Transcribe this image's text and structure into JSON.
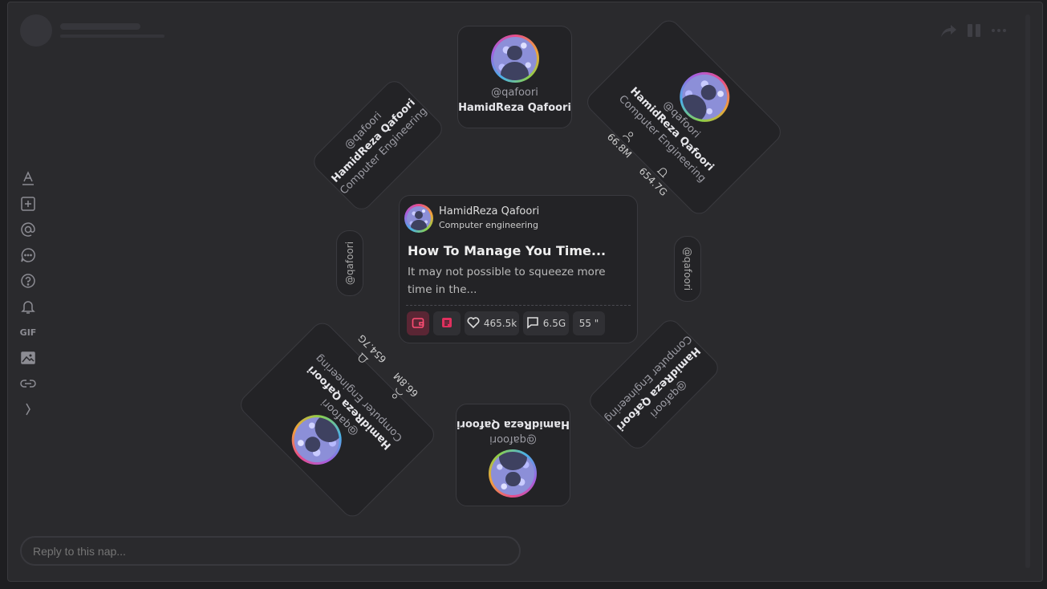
{
  "reply": {
    "placeholder": "Reply to this nap..."
  },
  "toolbar": {
    "gif_label": "GIF"
  },
  "profile": {
    "handle": "@qafoori",
    "name": "HamidReza Qafoori",
    "field": "Computer Engineering",
    "followers": "66.8M",
    "likes": "654.7G"
  },
  "post": {
    "author_name": "HamidReza Qafoori",
    "author_field": "Computer engineering",
    "title": "How To Manage You Time...",
    "excerpt": "It may not possible to squeeze more time in the...",
    "likes": "465.5k",
    "comments": "6.5G",
    "duration": "55 \""
  },
  "colors": {
    "accent": "#e0305e",
    "background": "#2a2a2d",
    "card": "#232326"
  },
  "icons": [
    "text-format-icon",
    "add-icon",
    "mention-icon",
    "chat-icon",
    "help-icon",
    "bell-icon",
    "image-icon",
    "link-icon",
    "chevron-right-icon",
    "share-icon",
    "pause-icon",
    "more-icon",
    "wallet-icon",
    "document-icon",
    "heart-icon",
    "comment-icon",
    "user-icon",
    "notification-icon"
  ]
}
